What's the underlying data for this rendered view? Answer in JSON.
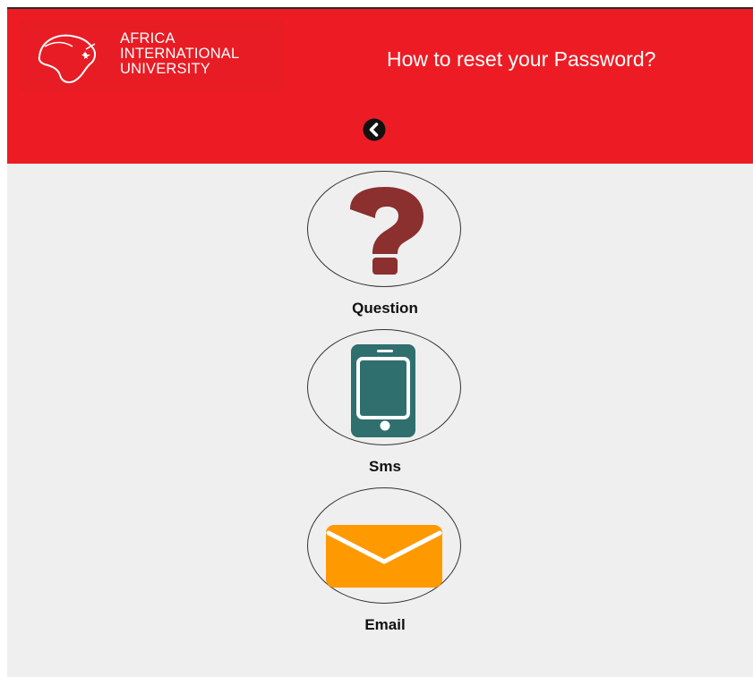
{
  "app": {
    "logo_lines": [
      "AFRICA",
      "INTERNATIONAL",
      "UNIVERSITY"
    ],
    "title": "How to reset your Password?",
    "back_icon": "chevron-left-circle-icon"
  },
  "options": [
    {
      "label": "Question",
      "icon": "question-mark-icon",
      "color": "#8b2f2f"
    },
    {
      "label": "Sms",
      "icon": "mobile-phone-icon",
      "color": "#2f6f6e"
    },
    {
      "label": "Email",
      "icon": "envelope-icon",
      "color": "#ff9900"
    }
  ],
  "colors": {
    "header_bg": "#ed1c24",
    "content_bg": "#efefef",
    "text_dark": "#111111"
  }
}
